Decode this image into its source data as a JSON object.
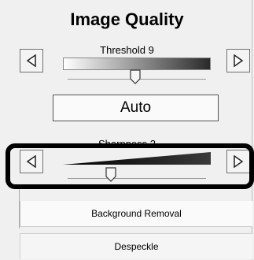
{
  "panel": {
    "title": "Image Quality"
  },
  "threshold": {
    "label": "Threshold 9",
    "value": 9
  },
  "auto_button": {
    "label": "Auto"
  },
  "sharpness": {
    "label": "Sharpness 2",
    "value": 2
  },
  "options": {
    "background_removal": "Background Removal",
    "despeckle": "Despeckle"
  },
  "icons": {
    "decrease": "triangle-left-icon",
    "increase": "triangle-right-icon",
    "thumb": "slider-thumb-icon"
  },
  "colors": {
    "highlight_outline": "#000000",
    "gradient_dark": "#2a2a2a"
  }
}
